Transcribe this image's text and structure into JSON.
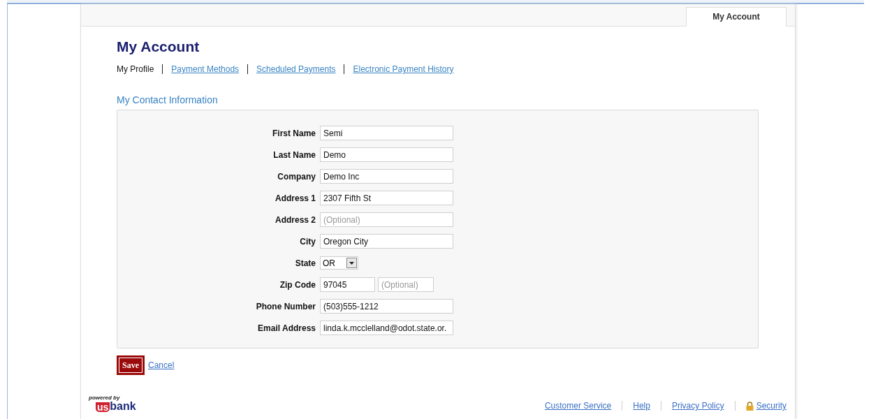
{
  "tabs": [
    {
      "label": "My Account",
      "selected": true
    }
  ],
  "title": "My Account",
  "nav": [
    {
      "label": "My Profile",
      "selected": true
    },
    {
      "label": "Payment Methods",
      "selected": false
    },
    {
      "label": "Scheduled Payments",
      "selected": false
    },
    {
      "label": "Electronic Payment History",
      "selected": false
    }
  ],
  "section_title": "My Contact Information",
  "fields": [
    {
      "kind": "text",
      "label": "First Name",
      "value": "Semi"
    },
    {
      "kind": "text",
      "label": "Last Name",
      "value": "Demo"
    },
    {
      "kind": "text",
      "label": "Company",
      "value": "Demo Inc"
    },
    {
      "kind": "text",
      "label": "Address 1",
      "value": "2307 Fifth St"
    },
    {
      "kind": "text",
      "label": "Address 2",
      "placeholder": "(Optional)"
    },
    {
      "kind": "text",
      "label": "City",
      "value": "Oregon City"
    },
    {
      "kind": "select",
      "label": "State",
      "value": "OR"
    },
    {
      "kind": "zip",
      "label": "Zip Code",
      "value": "97045",
      "extra_placeholder": "(Optional)"
    },
    {
      "kind": "text",
      "label": "Phone Number",
      "value": "(503)555-1212"
    },
    {
      "kind": "text",
      "label": "Email Address",
      "value": "linda.k.mcclelland@odot.state.or."
    }
  ],
  "buttons": {
    "save": "Save",
    "cancel": "Cancel"
  },
  "logo": {
    "tagline": "powered by",
    "mark": "us",
    "name": "bank"
  },
  "footer_links": [
    {
      "kind": "link",
      "label": "Customer Service"
    },
    {
      "kind": "link",
      "label": "Help"
    },
    {
      "kind": "link",
      "label": "Privacy Policy"
    },
    {
      "kind": "secure",
      "label": "Security"
    }
  ]
}
